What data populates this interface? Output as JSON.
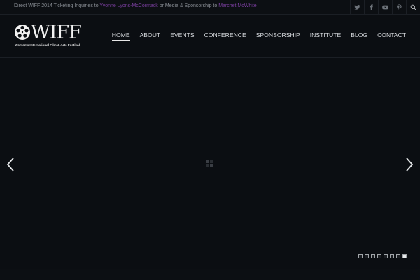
{
  "topbar": {
    "text_prefix": "Direct WIFF 2014 Ticketing Inquiries to ",
    "contact1": "Yvonne Lyons-McCormack",
    "text_mid": " or Media & Sponsorship to ",
    "contact2": "Marchet McWhite"
  },
  "social": [
    "twitter-icon",
    "facebook-icon",
    "youtube-icon",
    "pinterest-icon",
    "search-icon"
  ],
  "logo": {
    "word": "WIFF",
    "subtitle": "Women's International Film & Arts Festival"
  },
  "nav": {
    "items": [
      "HOME",
      "ABOUT",
      "EVENTS",
      "CONFERENCE",
      "SPONSORSHIP",
      "INSTITUTE",
      "BLOG",
      "CONTACT"
    ],
    "active": "HOME"
  },
  "slider": {
    "slide_count": 8,
    "active_slide": 8
  },
  "colors": {
    "background": "#0b0e12",
    "link": "#7b3fa0",
    "text": "#d8dbdf"
  }
}
